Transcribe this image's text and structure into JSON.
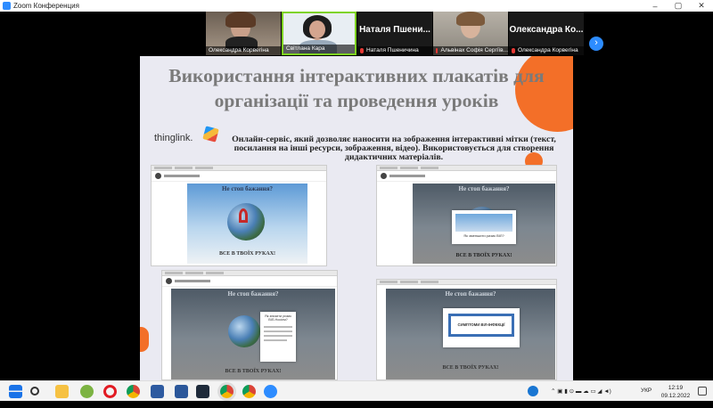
{
  "window": {
    "title": "Zoom Конференция"
  },
  "participants": [
    {
      "name": "Олександра Корвегіна",
      "type": "video",
      "muted": false
    },
    {
      "name": "Світлана Кара",
      "type": "video",
      "muted": false,
      "active_speaker": true
    },
    {
      "name": "Наталя Пшеничина",
      "short_name": "Наталя Пшени...",
      "type": "name-only",
      "muted": true
    },
    {
      "name": "Альвінах Софія Сергіїв...",
      "type": "video",
      "muted": true
    },
    {
      "name": "Олександра Корвегіна",
      "short_name": "Олександра Ко...",
      "type": "name-only",
      "muted": true
    }
  ],
  "slide": {
    "title": "Використання інтерактивних плакатів для організації та проведення уроків",
    "logo_text": "thinglink.",
    "description": "Онлайн-сервіс, який дозволяє наносити на зображення інтерактивні мітки (текст, посилання на інші ресурси, зображення, відео). Використовується для створення дидактичних матеріалів.",
    "screenshots": [
      {
        "top_text": "Не стоп бажання?",
        "bottom_text": "ВСЕ В ТВОЇХ РУКАХ!"
      },
      {
        "top_text": "Не стоп бажання?",
        "bottom_text": "ВСЕ В ТВОЇХ РУКАХ!",
        "modal_text": "Як зменшити ризик ВІЛ?"
      },
      {
        "top_text": "Не стоп бажання?",
        "bottom_text": "ВСЕ В ТВОЇХ РУКАХ!",
        "modal_title": "Як знизити ризик ВІЛ-Носієм?"
      },
      {
        "top_text": "Не стоп бажання?",
        "bottom_text": "ВСЕ В ТВОЇХ РУКАХ!",
        "modal_title": "СИМПТОМИ ВІЛ-ІНФЕКЦІЇ"
      }
    ]
  },
  "taskbar": {
    "language": "УКР",
    "time": "12:19",
    "date": "09.12.2022",
    "colors": {
      "windows": "#1a73e8",
      "zoom": "#2d8cff",
      "chrome_red": "#db4437",
      "opera": "#e21b23",
      "word": "#2b579a"
    }
  }
}
